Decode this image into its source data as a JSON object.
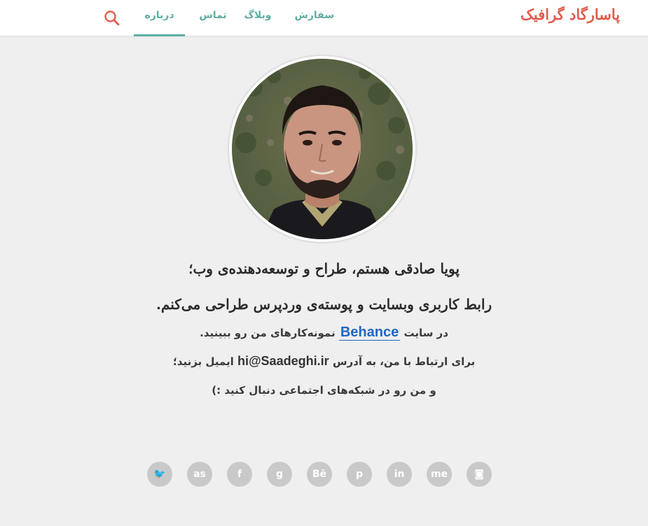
{
  "header": {
    "logo": "پاسارگاد گرافیک",
    "nav": [
      {
        "label": "سفارش"
      },
      {
        "label": "وبلاگ"
      },
      {
        "label": "تماس"
      },
      {
        "label": "درباره",
        "active": true
      }
    ],
    "search_icon": "search-icon"
  },
  "colors": {
    "accent": "#5eaea2",
    "brand": "#e25a4b",
    "link": "#1f66c2",
    "social_bg": "#c9c9c9"
  },
  "bio": {
    "line1": "پویا صادقی هستم، طراح و توسعه‌دهنده‌ی وب؛",
    "line2": "رابط کاربری وبسایت و پوسته‌ی وردپرس طراحی می‌کنم.",
    "line3_before": "در سایت",
    "line3_link": "Behance",
    "line3_after": "نمونه‌کارهای من رو ببینید.",
    "line4_before": "برای ارتباط با من، به آدرس",
    "line4_email": "hi@Saadeghi.ir",
    "line4_after": "ایمیل بزنید؛",
    "line5": "و من رو در شبکه‌های اجتماعی دنبال کنید :)"
  },
  "social": [
    {
      "icon": "twitter-icon",
      "glyph": "🐦"
    },
    {
      "icon": "lastfm-icon",
      "glyph": "as"
    },
    {
      "icon": "facebook-icon",
      "glyph": "f"
    },
    {
      "icon": "google-icon",
      "glyph": "g"
    },
    {
      "icon": "behance-icon",
      "glyph": "Bē"
    },
    {
      "icon": "pinterest-icon",
      "glyph": "p"
    },
    {
      "icon": "linkedin-icon",
      "glyph": "in"
    },
    {
      "icon": "aboutme-icon",
      "glyph": "me"
    },
    {
      "icon": "instagram-icon",
      "glyph": "◙"
    }
  ]
}
